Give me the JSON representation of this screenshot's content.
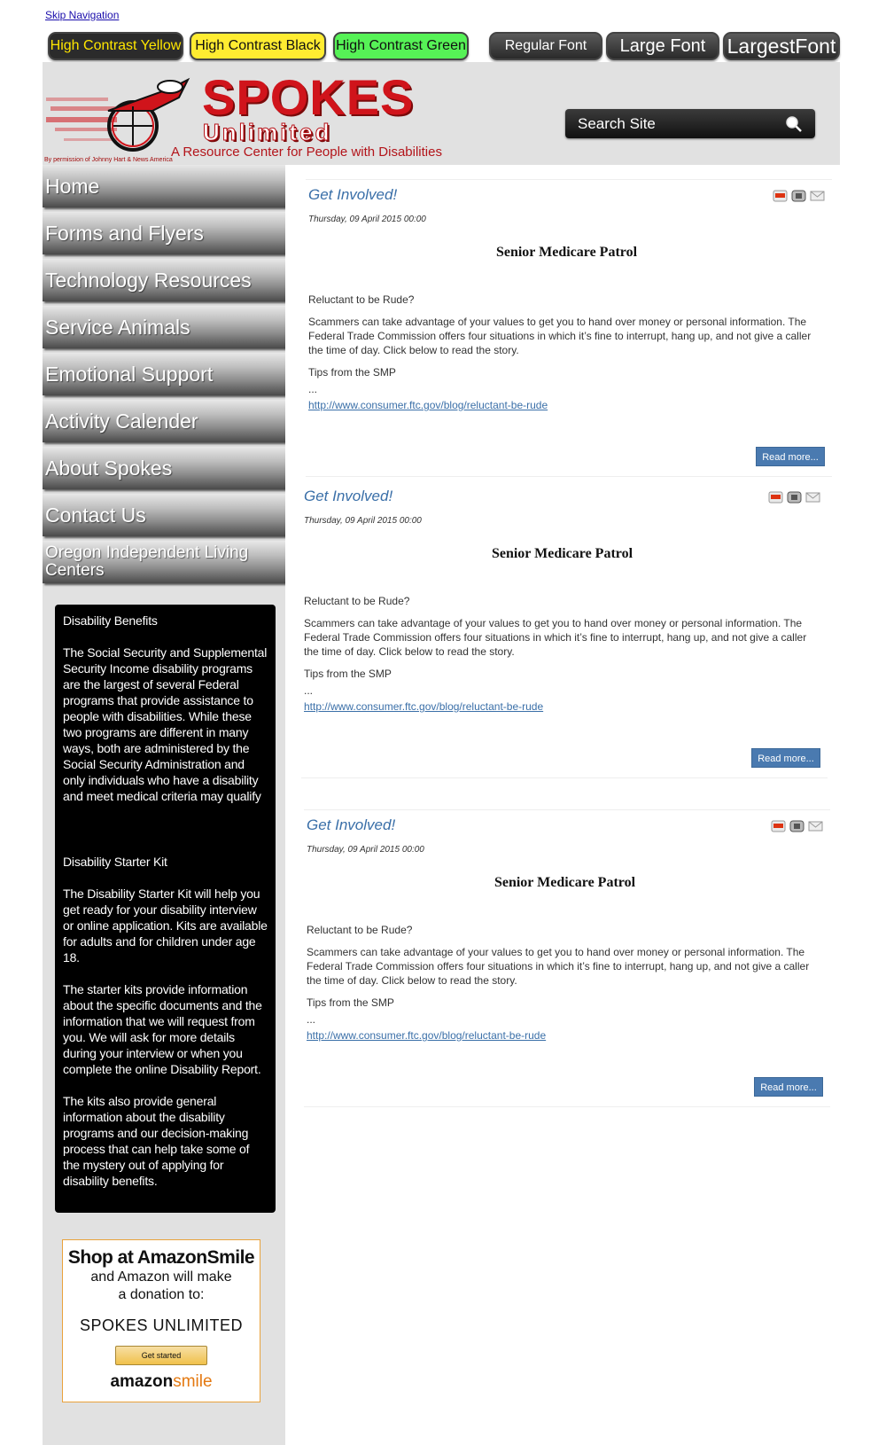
{
  "skip_nav": "Skip Navigation",
  "accessibility": {
    "contrast": [
      "High Contrast Yellow",
      "High Contrast Black",
      "High Contrast Green"
    ],
    "fonts": [
      "Regular Font",
      "Large Font",
      "LargestFont"
    ]
  },
  "header": {
    "brand_main": "SPOKES",
    "brand_sub": "Unlimited",
    "tagline": "A Resource Center for People with Disabilities",
    "credit": "By permission of Johnny Hart & News America",
    "search_label": "Search Site"
  },
  "nav": [
    "Home",
    "Forms and Flyers",
    "Technology Resources",
    "Service Animals",
    "Emotional Support",
    "Activity Calender",
    "About Spokes",
    "Contact Us",
    "Oregon Independent Living Centers"
  ],
  "benefits": {
    "heading1": "Disability Benefits",
    "para1": "The Social Security and Supplemental Security Income disability programs are the largest of several Federal programs that provide assistance to people with disabilities. While these two programs are different in many ways, both are administered by the Social Security Administration and only individuals who have a disability and meet medical criteria may qualify",
    "heading2": "Disability Starter Kit",
    "para2": "The Disability Starter Kit will help you get ready for your disability interview or online application. Kits are available for adults and for children under age 18.",
    "para3": "The starter kits provide information about the specific documents and the information that we will request from you. We will ask for more details during your interview or when you complete the online Disability Report.",
    "para4": "The kits also provide general information about the disability programs and our decision-making process that can help take some of the mystery out of applying for disability benefits."
  },
  "amazon": {
    "title": "Shop at AmazonSmile",
    "line1": "and Amazon will make",
    "line2": "a donation to:",
    "org": "SPOKES UNLIMITED",
    "button": "Get started",
    "logo_main": "amazon",
    "logo_smile": "smile"
  },
  "articles": [
    {
      "category": "Get Involved!",
      "date": "Thursday, 09 April 2015 00:00",
      "headline": "Senior Medicare Patrol",
      "q": "Reluctant to be Rude?",
      "body": "Scammers can take advantage of your values to get you to hand over money or personal information. The Federal Trade Commission offers four situations in which it’s fine to interrupt, hang up, and not give a caller the time of day. Click below to read the story.",
      "tips": "Tips from the SMP",
      "ellipsis": "...",
      "link": "http://www.consumer.ftc.gov/blog/reluctant-be-rude",
      "read_more": "Read more..."
    },
    {
      "category": "Get Involved!",
      "date": "Thursday, 09 April 2015 00:00",
      "headline": "Senior Medicare Patrol",
      "q": "Reluctant to be Rude?",
      "body": "Scammers can take advantage of your values to get you to hand over money or personal information. The Federal Trade Commission offers four situations in which it’s fine to interrupt, hang up, and not give a caller the time of day. Click below to read the story.",
      "tips": "Tips from the SMP",
      "ellipsis": "...",
      "link": "http://www.consumer.ftc.gov/blog/reluctant-be-rude",
      "read_more": "Read more..."
    },
    {
      "category": "Get Involved!",
      "date": "Thursday, 09 April 2015 00:00",
      "headline": "Senior Medicare Patrol",
      "q": "Reluctant to be Rude?",
      "body": "Scammers can take advantage of your values to get you to hand over money or personal information. The Federal Trade Commission offers four situations in which it’s fine to interrupt, hang up, and not give a caller the time of day. Click below to read the story.",
      "tips": "Tips from the SMP",
      "ellipsis": "...",
      "link": "http://www.consumer.ftc.gov/blog/reluctant-be-rude",
      "read_more": "Read more..."
    }
  ],
  "icons": [
    "pdf-icon",
    "print-icon",
    "email-icon",
    "search-icon"
  ],
  "colors": {
    "brand_red": "#d0141b",
    "link_blue": "#3a6fa8",
    "contrast_yellow": "#ffec31",
    "contrast_green": "#56f256"
  }
}
